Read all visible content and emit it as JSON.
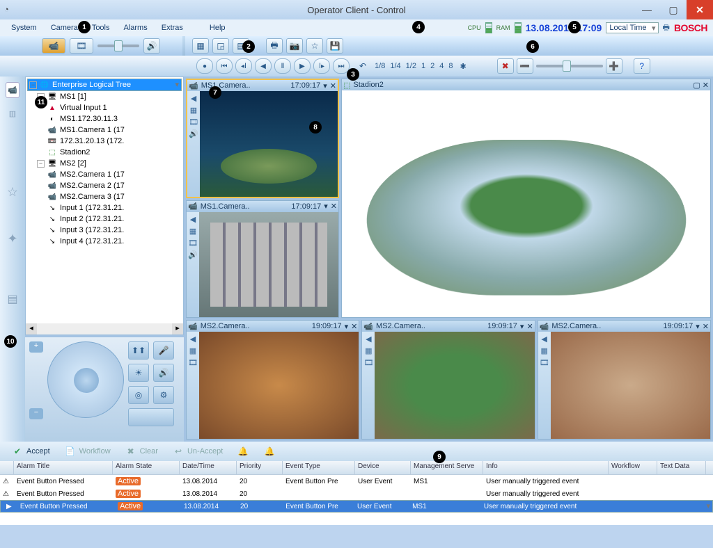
{
  "window": {
    "title": "Operator Client - Control"
  },
  "menu": {
    "items": [
      "System",
      "Camera",
      "Tools",
      "Alarms",
      "Extras",
      "Help"
    ],
    "datetime": "13.08.2014 17:09",
    "tz_label": "Local Time",
    "brand": "BOSCH",
    "cpu": "CPU",
    "ram": "RAM"
  },
  "tree": {
    "root": "Enterprise Logical Tree",
    "ms1": {
      "label": "MS1 [1]",
      "children": [
        "Virtual Input 1",
        "MS1.172.30.11.3",
        "MS1.Camera 1 (17",
        "172.31.20.13 (172.",
        "Stadion2"
      ]
    },
    "ms2": {
      "label": "MS2 [2]",
      "children": [
        "MS2.Camera 1 (17",
        "MS2.Camera 2 (17",
        "MS2.Camera 3 (17",
        "Input 1 (172.31.21.",
        "Input 2 (172.31.21.",
        "Input 3 (172.31.21.",
        "Input 4 (172.31.21."
      ]
    }
  },
  "play": {
    "ticks": [
      "1/8",
      "1/4",
      "1/2",
      "1",
      "2",
      "4",
      "8"
    ]
  },
  "panes": {
    "p1": {
      "title": "MS1.Camera..",
      "time": "17:09:17"
    },
    "p2": {
      "title": "Stadion2"
    },
    "p3": {
      "title": "MS1.Camera..",
      "time": "17:09:17"
    },
    "p4": {
      "title": "MS2.Camera..",
      "time": "19:09:17"
    },
    "p5": {
      "title": "MS2.Camera..",
      "time": "19:09:17"
    },
    "p6": {
      "title": "MS2.Camera..",
      "time": "19:09:17"
    }
  },
  "alarmbar": {
    "accept": "Accept",
    "workflow": "Workflow",
    "clear": "Clear",
    "unaccept": "Un-Accept"
  },
  "grid": {
    "headers": {
      "title": "Alarm Title",
      "state": "Alarm State",
      "dt": "Date/Time",
      "pri": "Priority",
      "et": "Event Type",
      "dev": "Device",
      "ms": "Management Serve",
      "info": "Info",
      "wf": "Workflow",
      "td": "Text Data"
    },
    "state_label": "Active",
    "rows": [
      {
        "title": "Event Button Pressed",
        "dt": "13.08.2014",
        "pri": "20",
        "et": "Event Button Pre",
        "dev": "User Event",
        "ms": "MS1",
        "info": "User manually triggered event"
      },
      {
        "title": "Event Button Pressed",
        "dt": "13.08.2014",
        "pri": "20",
        "et": "",
        "dev": "",
        "ms": "",
        "info": "User manually triggered event"
      },
      {
        "title": "Event Button Pressed",
        "dt": "13.08.2014",
        "pri": "20",
        "et": "Event Button Pre",
        "dev": "User Event",
        "ms": "MS1",
        "info": "User manually triggered event"
      }
    ]
  },
  "callouts": {
    "1": "1",
    "2": "2",
    "3": "3",
    "4": "4",
    "5": "5",
    "6": "6",
    "7": "7",
    "8": "8",
    "9": "9",
    "10": "10",
    "11": "11"
  }
}
